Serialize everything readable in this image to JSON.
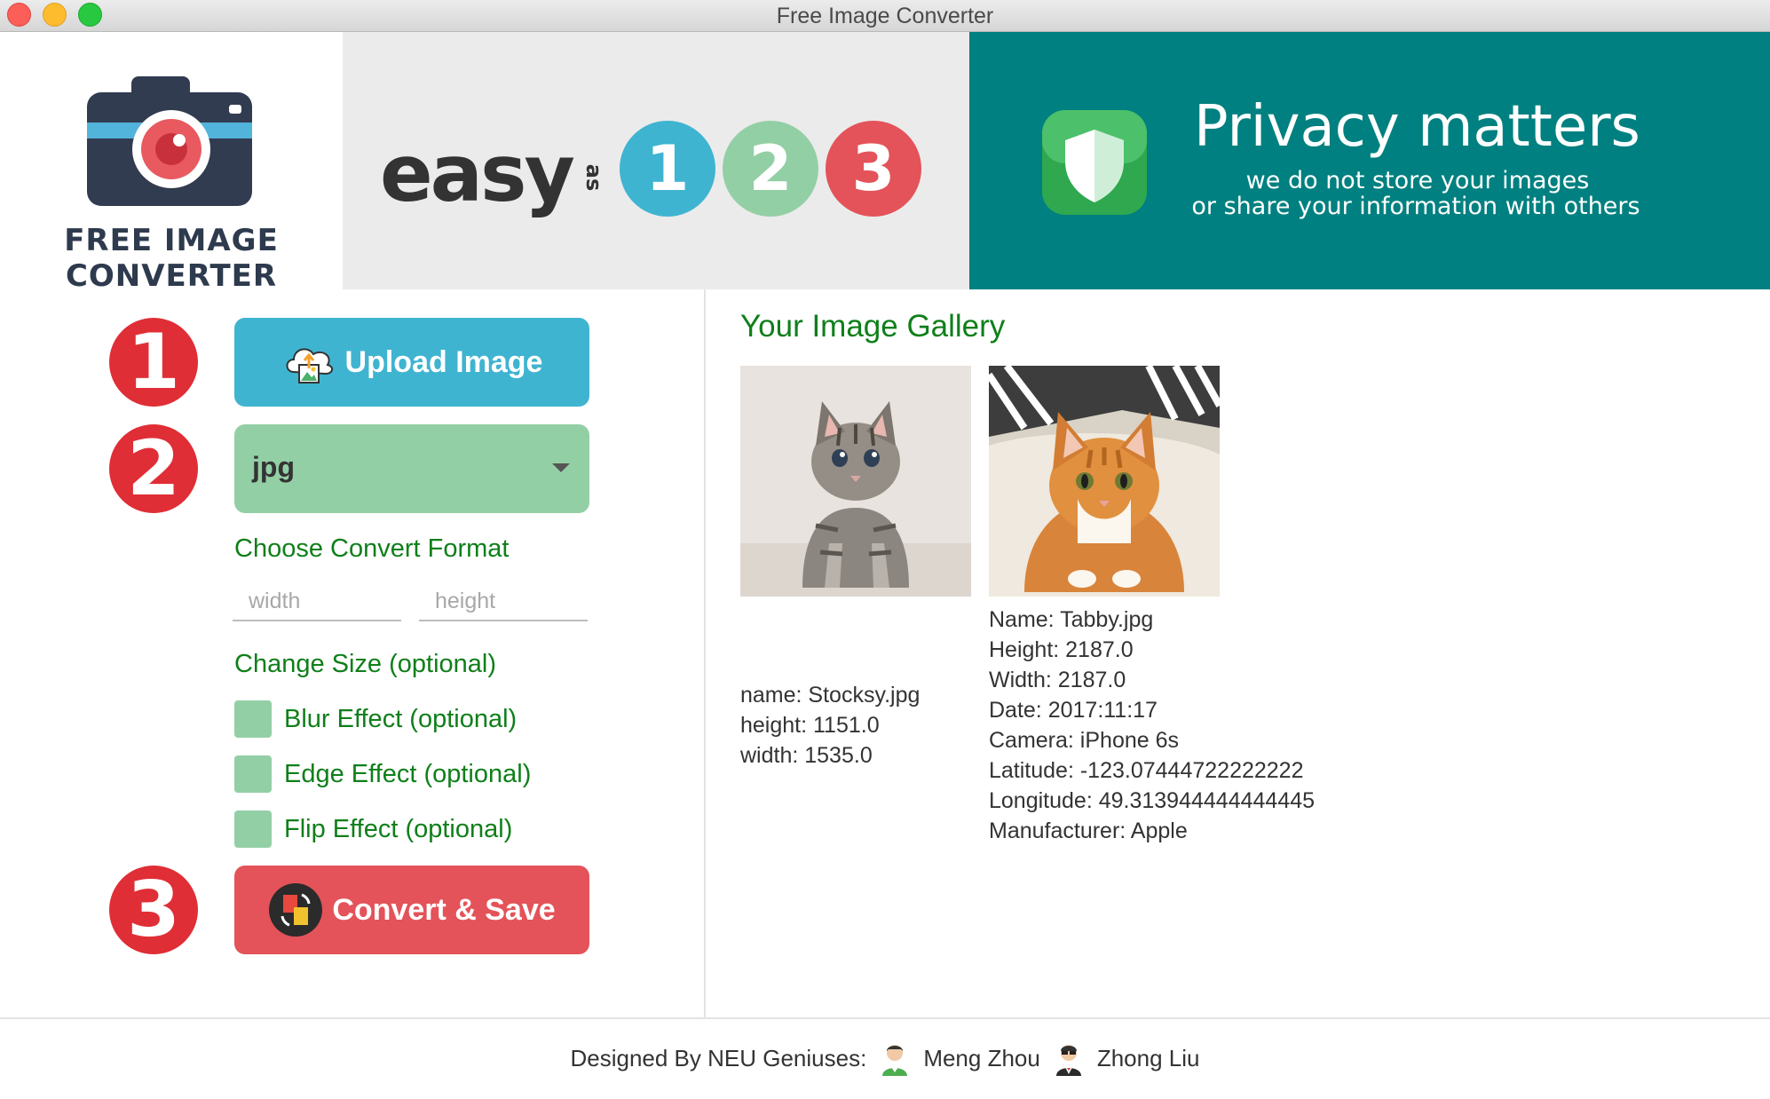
{
  "window": {
    "title": "Free Image Converter"
  },
  "banner": {
    "logo_text": "FREE IMAGE CONVERTER",
    "easy_word": "easy",
    "as_word": "as",
    "steps": [
      "1",
      "2",
      "3"
    ],
    "step_colors": [
      "#3fb4d1",
      "#93cfa5",
      "#e35359"
    ],
    "privacy_title": "Privacy matters",
    "privacy_line1": "we do not store your images",
    "privacy_line2": "or share your information with others"
  },
  "controls": {
    "step_numbers": [
      "1",
      "2",
      "3"
    ],
    "upload_label": "Upload Image",
    "format_value": "jpg",
    "format_label": "Choose Convert Format",
    "width_placeholder": "width",
    "height_placeholder": "height",
    "size_label": "Change Size (optional)",
    "effects": [
      "Blur Effect (optional)",
      "Edge Effect (optional)",
      "Flip Effect (optional)"
    ],
    "convert_label": "Convert & Save"
  },
  "gallery": {
    "title": "Your Image Gallery",
    "images": [
      {
        "lines": [
          "name: Stocksy.jpg",
          "height: 1151.0",
          "width: 1535.0"
        ]
      },
      {
        "lines": [
          "Name: Tabby.jpg",
          "Height: 2187.0",
          "Width: 2187.0",
          "Date: 2017:11:17",
          "Camera: iPhone 6s",
          "Latitude: -123.07444722222222",
          "Longitude: 49.313944444444445",
          "Manufacturer: Apple"
        ]
      }
    ]
  },
  "footer": {
    "designed_by": "Designed By NEU Geniuses:",
    "author1": "Meng Zhou",
    "author2": "Zhong Liu"
  },
  "colors": {
    "accent_teal": "#008080",
    "upload_blue": "#3fb4d1",
    "select_green": "#93cfa5",
    "convert_red": "#e35359",
    "label_green": "#0f7f1a"
  }
}
